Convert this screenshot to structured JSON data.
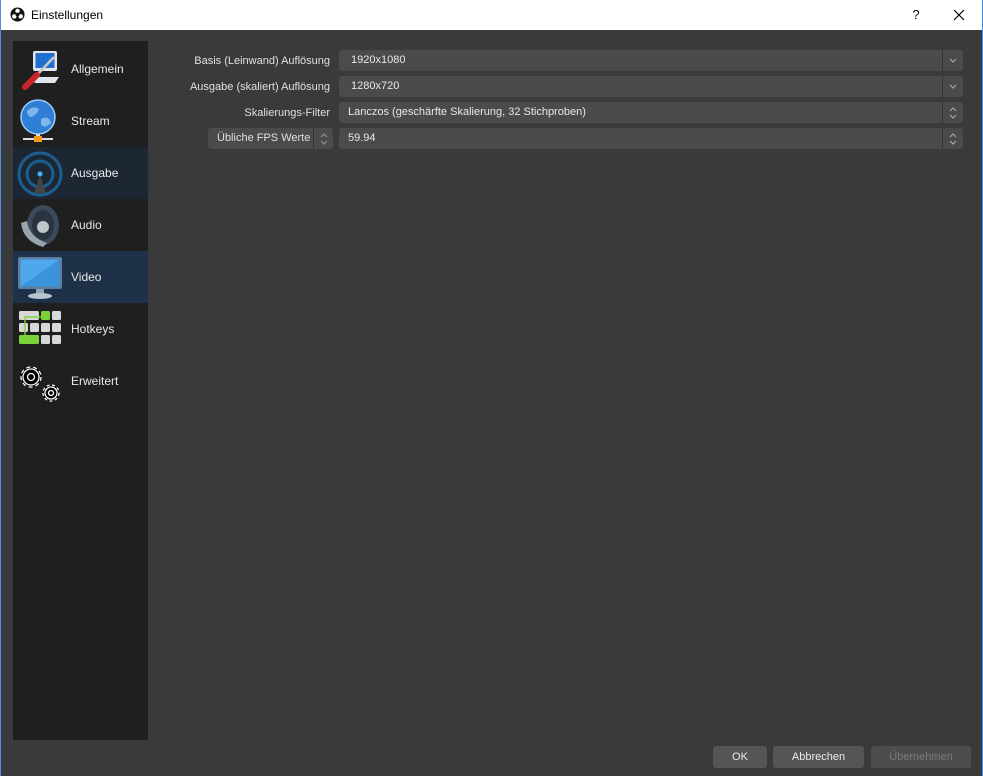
{
  "window": {
    "title": "Einstellungen",
    "help_label": "?",
    "icon": "obs-logo-icon",
    "close_icon": "close-icon"
  },
  "sidebar": {
    "items": [
      {
        "label": "Allgemein",
        "icon": "general-settings-icon",
        "state": "normal"
      },
      {
        "label": "Stream",
        "icon": "stream-globe-icon",
        "state": "normal"
      },
      {
        "label": "Ausgabe",
        "icon": "output-antenna-icon",
        "state": "hover"
      },
      {
        "label": "Audio",
        "icon": "audio-speaker-icon",
        "state": "normal"
      },
      {
        "label": "Video",
        "icon": "video-monitor-icon",
        "state": "selected"
      },
      {
        "label": "Hotkeys",
        "icon": "hotkeys-keyboard-icon",
        "state": "normal"
      },
      {
        "label": "Erweitert",
        "icon": "advanced-gears-icon",
        "state": "normal"
      }
    ]
  },
  "video": {
    "base_resolution": {
      "label": "Basis (Leinwand) Auflösung",
      "value": "1920x1080"
    },
    "output_resolution": {
      "label": "Ausgabe (skaliert) Auflösung",
      "value": "1280x720"
    },
    "downscale_filter": {
      "label": "Skalierungs-Filter",
      "value": "Lanczos (geschärfte Skalierung, 32 Stichproben)"
    },
    "fps": {
      "type_label": "Übliche FPS Werte",
      "value": "59.94"
    }
  },
  "footer": {
    "ok_label": "OK",
    "cancel_label": "Abbrechen",
    "apply_label": "Übernehmen"
  }
}
